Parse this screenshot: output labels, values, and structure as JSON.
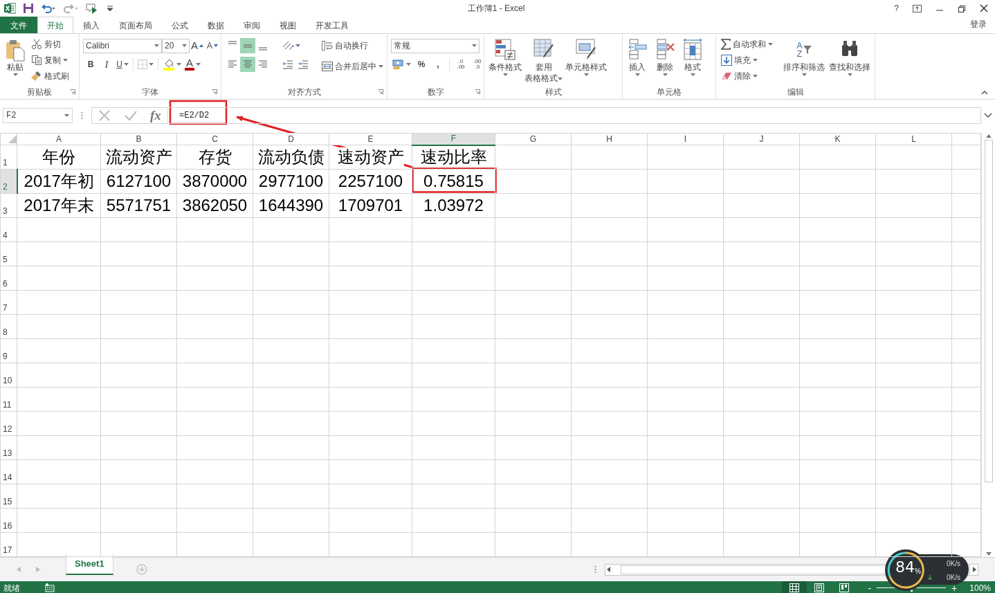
{
  "title_bar": {
    "title": "工作簿1 - Excel",
    "help": "?"
  },
  "ribbon_tabs": [
    {
      "label": "文件",
      "kind": "file",
      "selected": false
    },
    {
      "label": "开始",
      "kind": "tab",
      "selected": true
    },
    {
      "label": "插入",
      "kind": "tab",
      "selected": false
    },
    {
      "label": "页面布局",
      "kind": "tab",
      "selected": false
    },
    {
      "label": "公式",
      "kind": "tab",
      "selected": false
    },
    {
      "label": "数据",
      "kind": "tab",
      "selected": false
    },
    {
      "label": "审阅",
      "kind": "tab",
      "selected": false
    },
    {
      "label": "视图",
      "kind": "tab",
      "selected": false
    },
    {
      "label": "开发工具",
      "kind": "tab",
      "selected": false
    }
  ],
  "account": "登录",
  "clipboard": {
    "label": "剪贴板",
    "paste": "粘贴",
    "cut": "剪切",
    "copy": "复制",
    "format_painter": "格式刷"
  },
  "font": {
    "label": "字体",
    "font_name": "Calibri",
    "font_size": "20",
    "grow": "A",
    "shrink": "A",
    "bold": "B",
    "italic": "I",
    "underline": "U",
    "font_color": "A"
  },
  "alignment": {
    "label": "对齐方式",
    "vertical": [
      {
        "selected": false
      },
      {
        "selected": true
      },
      {
        "selected": false
      }
    ],
    "horizontal": [
      {
        "selected": false
      },
      {
        "selected": true
      },
      {
        "selected": false
      }
    ],
    "wrap_text": "自动换行",
    "merge_center": "合并后居中"
  },
  "number": {
    "label": "数字",
    "format": "常规",
    "percent": "%",
    "comma": ",",
    "increase_decimal": [
      ".0",
      ".00"
    ],
    "decrease_decimal": [
      ".00",
      ".0"
    ]
  },
  "styles": {
    "label": "样式",
    "buttons": [
      {
        "lines": [
          "条件格式"
        ]
      },
      {
        "lines": [
          "套用",
          "表格格式"
        ]
      },
      {
        "lines": [
          "单元格样式"
        ]
      }
    ]
  },
  "cells": {
    "label": "单元格",
    "buttons": [
      "插入",
      "删除",
      "格式"
    ]
  },
  "editing": {
    "label": "编辑",
    "autosum": "自动求和",
    "fill": "填充",
    "clear": "清除",
    "sort_letters": [
      "A",
      "Z"
    ],
    "sort_filter": "排序和筛选",
    "find_select": "查找和选择"
  },
  "formula_bar": {
    "name_box": "F2",
    "fx": "fx",
    "formula": "=E2/D2"
  },
  "sheet": {
    "columns": [
      {
        "label": "A",
        "selected": false
      },
      {
        "label": "B",
        "selected": false
      },
      {
        "label": "C",
        "selected": false
      },
      {
        "label": "D",
        "selected": false
      },
      {
        "label": "E",
        "selected": false
      },
      {
        "label": "F",
        "selected": true
      },
      {
        "label": "G",
        "selected": false
      },
      {
        "label": "H",
        "selected": false
      },
      {
        "label": "I",
        "selected": false
      },
      {
        "label": "J",
        "selected": false
      },
      {
        "label": "K",
        "selected": false
      },
      {
        "label": "L",
        "selected": false
      }
    ],
    "rows": [
      {
        "label": "1",
        "selected": false,
        "cells": [
          "年份",
          "流动资产",
          "存货",
          "流动负债",
          "速动资产",
          "速动比率"
        ]
      },
      {
        "label": "2",
        "selected": true,
        "cells": [
          "2017年初",
          "6127100",
          "3870000",
          "2977100",
          "2257100",
          "0.75815"
        ]
      },
      {
        "label": "3",
        "selected": false,
        "cells": [
          "2017年末",
          "5571751",
          "3862050",
          "1644390",
          "1709701",
          "1.03972"
        ]
      },
      {
        "label": "4",
        "selected": false
      },
      {
        "label": "5",
        "selected": false
      },
      {
        "label": "6",
        "selected": false
      },
      {
        "label": "7",
        "selected": false
      },
      {
        "label": "8",
        "selected": false
      },
      {
        "label": "9",
        "selected": false
      },
      {
        "label": "10",
        "selected": false
      },
      {
        "label": "11",
        "selected": false
      },
      {
        "label": "12",
        "selected": false
      },
      {
        "label": "13",
        "selected": false
      },
      {
        "label": "14",
        "selected": false
      },
      {
        "label": "15",
        "selected": false
      },
      {
        "label": "16",
        "selected": false
      },
      {
        "label": "17",
        "selected": false
      }
    ]
  },
  "sheet_tabs": [
    {
      "label": "Sheet1",
      "selected": true
    }
  ],
  "status_bar": {
    "status": "就绪",
    "views": [
      {
        "kind": "normal",
        "selected": true
      },
      {
        "kind": "page_layout",
        "selected": false
      },
      {
        "kind": "page_break",
        "selected": false
      }
    ],
    "zoom_out": "-",
    "zoom_in": "+",
    "level": 0.5,
    "zoom": "100%"
  },
  "speed_widget": {
    "percent": "84",
    "unit": "%",
    "upload": "0K/s",
    "download": "0K/s"
  }
}
